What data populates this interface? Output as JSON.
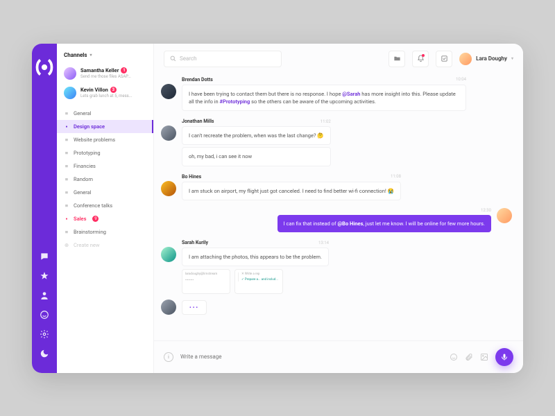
{
  "sidebar": {
    "header": "Channels",
    "dms": [
      {
        "name": "Samantha Keller",
        "badge": "1",
        "preview": "Send me those files ASAP..."
      },
      {
        "name": "Kevin Villon",
        "badge": "3",
        "preview": "Lets grab lunch at 5, mess..."
      }
    ],
    "channels": [
      {
        "label": "General"
      },
      {
        "label": "Design space",
        "active": true
      },
      {
        "label": "Website problems"
      },
      {
        "label": "Prototyping"
      },
      {
        "label": "Financies"
      },
      {
        "label": "Random"
      },
      {
        "label": "General"
      },
      {
        "label": "Conference talks"
      },
      {
        "label": "Sales",
        "alert": true,
        "badge": "9"
      },
      {
        "label": "Brainstorming"
      }
    ],
    "create": "Create new"
  },
  "topbar": {
    "search_placeholder": "Search",
    "user": "Lara Doughy"
  },
  "messages": [
    {
      "author": "Brendan Dotts",
      "time": "10:04",
      "bubbles": [
        "I have been trying to contact them but there is no response. I hope @Sarah has more insight into this. Please update all the info in #Prototyping so the others can be aware of the upcoming activities."
      ]
    },
    {
      "author": "Jonathan Mills",
      "time": "11:02",
      "bubbles": [
        "I can't recreate the problem, when was the last change? 🤔",
        "oh, my bad, i can see it now"
      ]
    },
    {
      "author": "Bo Hines",
      "time": "11:08",
      "bubbles": [
        "I am stuck on airport, my flight just got canceled. I need to find better wi-fi connection! 😭"
      ]
    },
    {
      "self": true,
      "time": "12:30",
      "bubbles": [
        "I can fix that instead of @Bo Hines, just let me know. I will be online for few more hours."
      ]
    },
    {
      "author": "Sarah Kurily",
      "time": "13:14",
      "bubbles": [
        "I am attaching the photos, this appears to be the problem."
      ],
      "attachments": [
        {
          "line1": "laradoughy@limstream",
          "line2": "••••••••"
        },
        {
          "line1": "✕  Write a rep",
          "line2": "✓  Prepare a... and includ..."
        }
      ]
    }
  ],
  "composer": {
    "placeholder": "Write a message"
  }
}
